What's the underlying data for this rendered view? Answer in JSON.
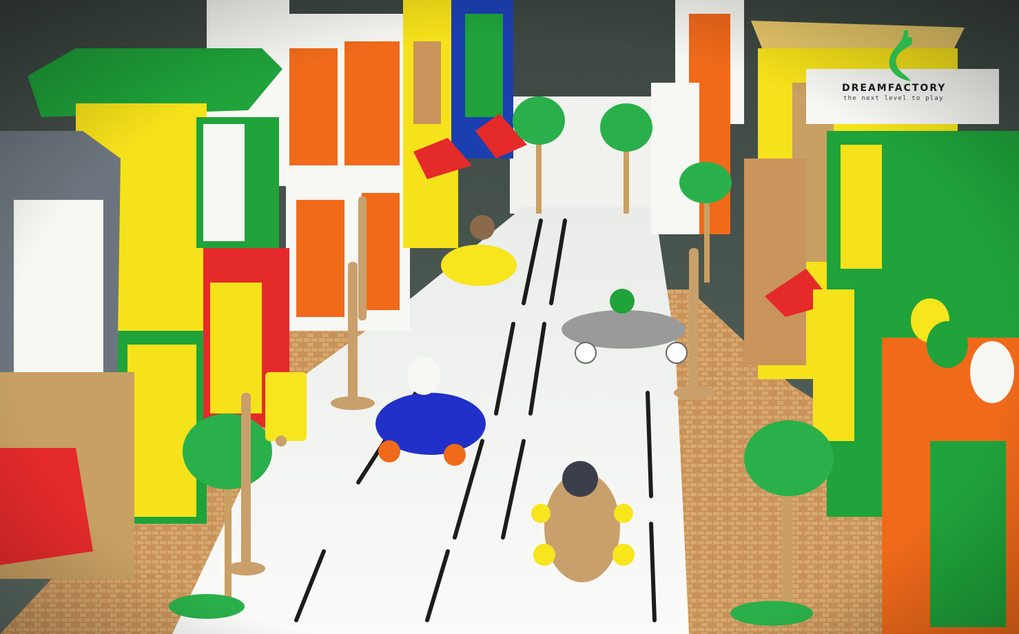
{
  "brand": {
    "name": "DREAMFACTORY",
    "tagline": "the next level to play"
  },
  "colors": {
    "road": "#f4f5f2",
    "lane_marking": "#1c1c1c",
    "sidewalk": "#c9955c",
    "building_green": "#1fa33a",
    "building_yellow": "#f6e21a",
    "building_orange": "#f06a1a",
    "building_red": "#e52a2a",
    "building_white": "#f7f7f3",
    "building_blue": "#1b3fb0",
    "building_gray": "#6c757d",
    "tree_foliage": "#2ab04a",
    "tree_trunk": "#c8a063",
    "car_blue": "#2030c8",
    "car_yellow": "#f7e51e",
    "car_gray": "#9a9a9a",
    "car_bronze": "#c9a06b",
    "logo_green": "#2bb54a"
  },
  "icons": {
    "logo": "dreamfactory-logo-icon"
  }
}
